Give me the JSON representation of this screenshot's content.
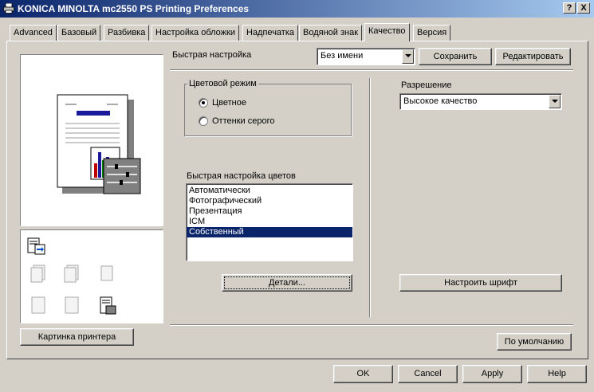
{
  "window": {
    "title": "KONICA MINOLTA mc2550 PS Printing Preferences",
    "help_btn": "?",
    "close_btn": "X"
  },
  "tabs": [
    {
      "label": "Advanced"
    },
    {
      "label": "Базовый"
    },
    {
      "label": "Разбивка"
    },
    {
      "label": "Настройка обложки"
    },
    {
      "label": "Надпечатка"
    },
    {
      "label": "Водяной знак"
    },
    {
      "label": "Качество"
    },
    {
      "label": "Версия"
    }
  ],
  "active_tab": "Качество",
  "quick_setting": {
    "label": "Быстрая настройка",
    "value": "Без имени",
    "save_label": "Сохранить",
    "edit_label": "Редактировать"
  },
  "color_mode": {
    "legend": "Цветовой режим",
    "options": [
      "Цветное",
      "Оттенки серого"
    ],
    "selected": "Цветное"
  },
  "quick_color": {
    "label": "Быстрая настройка цветов",
    "items": [
      "Автоматически",
      "Фотографический",
      "Презентация",
      "ICM",
      "Собственный"
    ],
    "selected": "Собственный",
    "details_label": "Детали..."
  },
  "resolution": {
    "label": "Разрешение",
    "value": "Высокое качество"
  },
  "font_button": "Настроить шрифт",
  "printer_picture_button": "Картинка принтера",
  "default_button": "По умолчанию",
  "footer": {
    "ok": "OK",
    "cancel": "Cancel",
    "apply": "Apply",
    "help": "Help"
  },
  "colors": {
    "titlebar_start": "#0a246a",
    "titlebar_end": "#a6caf0",
    "selection": "#0a246a",
    "face": "#d4d0c8"
  }
}
